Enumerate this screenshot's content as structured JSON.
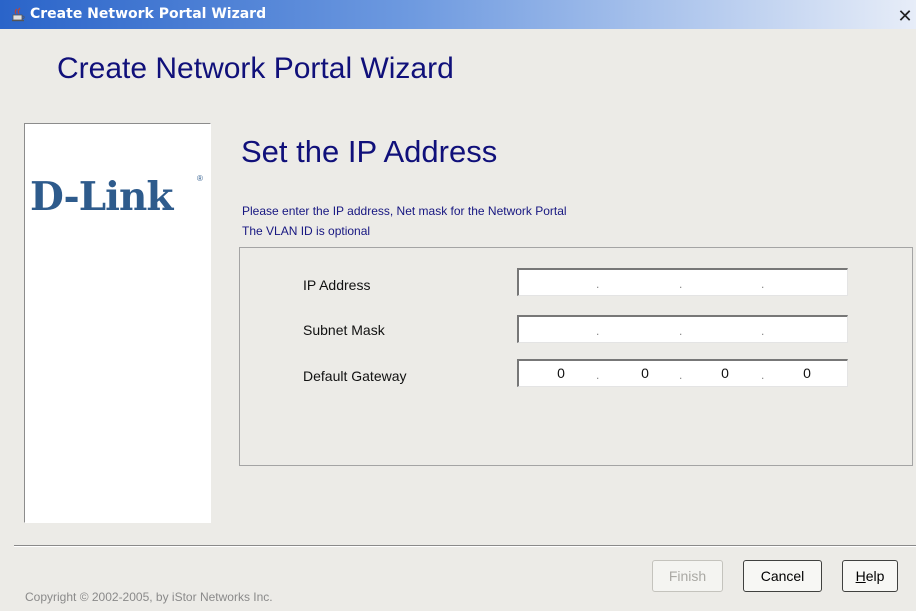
{
  "window": {
    "title": "Create Network Portal Wizard",
    "title_icon": "java-cup-icon",
    "close_glyph": "✕"
  },
  "heading": "Create Network Portal Wizard",
  "logo": {
    "text": "D-Link",
    "registered": "®",
    "color": "#2e5b8c"
  },
  "step": {
    "title": "Set the IP Address",
    "instructions": [
      "Please enter the IP address, Net mask for the Network Portal",
      "The VLAN ID is optional"
    ]
  },
  "fields": {
    "ip_address": {
      "label": "IP Address",
      "octets": [
        "",
        "",
        "",
        ""
      ]
    },
    "subnet_mask": {
      "label": "Subnet Mask",
      "octets": [
        "",
        "",
        "",
        ""
      ]
    },
    "default_gateway": {
      "label": "Default Gateway",
      "octets": [
        "0",
        "0",
        "0",
        "0"
      ]
    },
    "octet_separator": "."
  },
  "footer": {
    "copyright": "Copyright © 2002-2005, by iStor Networks Inc."
  },
  "buttons": {
    "finish": {
      "label": "Finish",
      "enabled": false
    },
    "cancel": {
      "label": "Cancel"
    },
    "help": {
      "label_first": "H",
      "label_rest": "elp"
    }
  },
  "colors": {
    "title_bar": "#2a64c9",
    "heading": "#10107a",
    "background": "#ecebe7"
  }
}
